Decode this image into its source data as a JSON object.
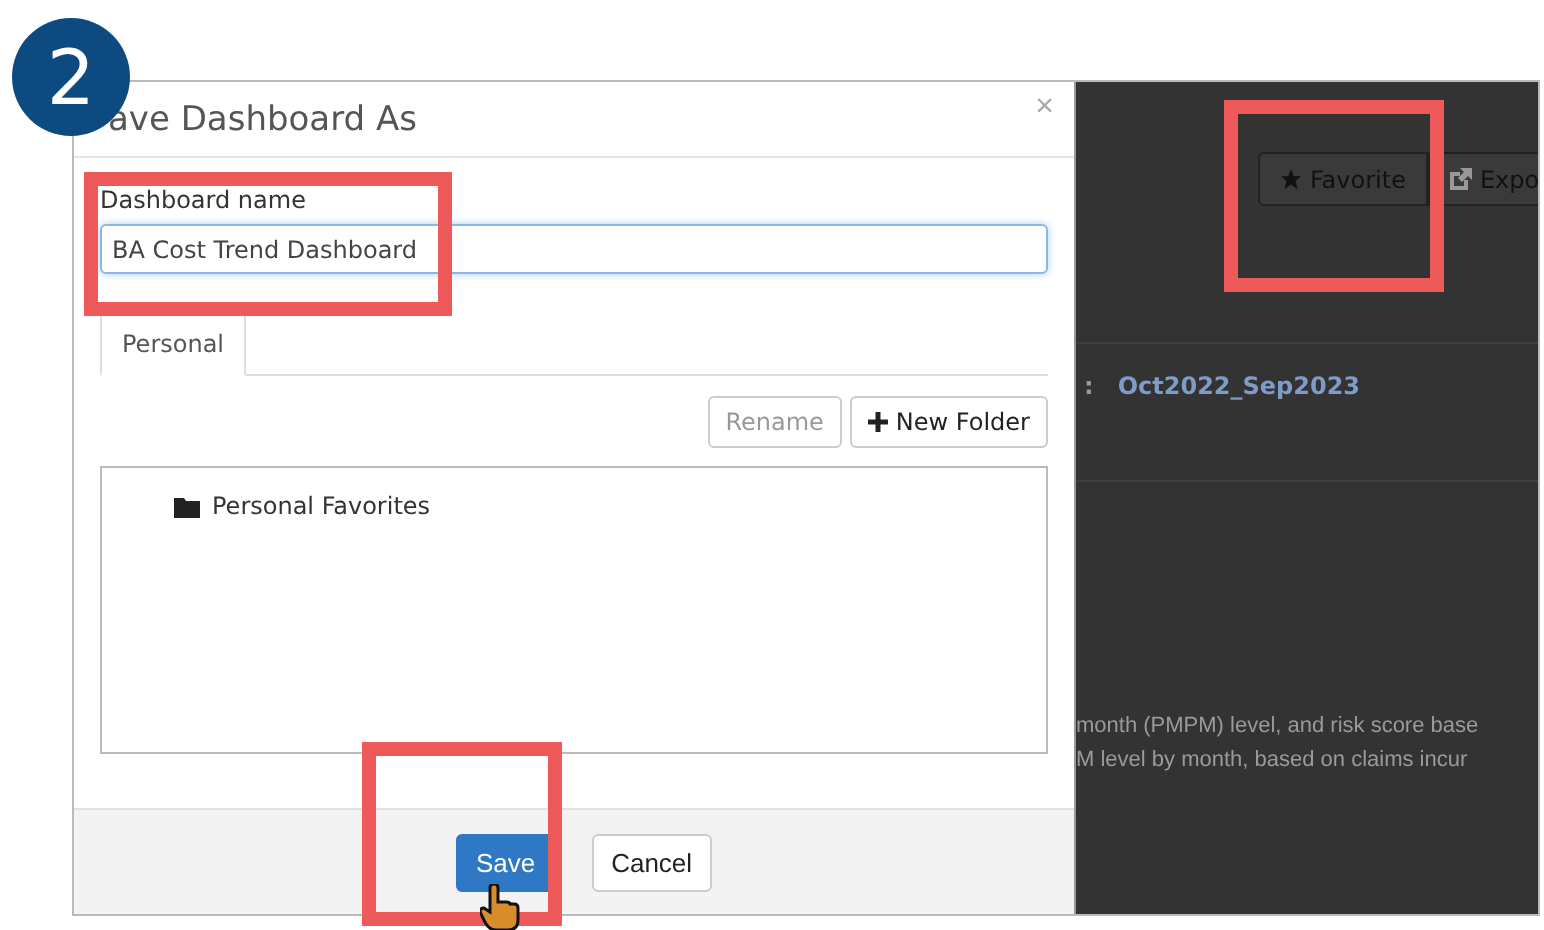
{
  "step_badge": "2",
  "dialog": {
    "title": "ave Dashboard As",
    "close": "×",
    "name_label": "Dashboard name",
    "name_value": "BA Cost Trend Dashboard",
    "tabs": [
      {
        "label": "Personal",
        "selected": true
      }
    ],
    "buttons": [
      {
        "label": "Rename",
        "disabled": true,
        "icon": false
      },
      {
        "label": "New Folder",
        "disabled": false,
        "icon": true
      }
    ],
    "folders": [
      {
        "label": "Personal Favorites"
      }
    ],
    "footer_buttons": [
      {
        "label": "Save",
        "kind": "primary"
      },
      {
        "label": "Cancel",
        "kind": "default"
      }
    ]
  },
  "background": {
    "toolbar": [
      {
        "label": "Favorite",
        "kind": "star"
      },
      {
        "label": "Expo",
        "kind": "export"
      }
    ],
    "separator": ":",
    "period": "Oct2022_Sep2023",
    "lines": [
      "month (PMPM) level, and risk score base",
      "M level by month, based on claims incur"
    ]
  }
}
